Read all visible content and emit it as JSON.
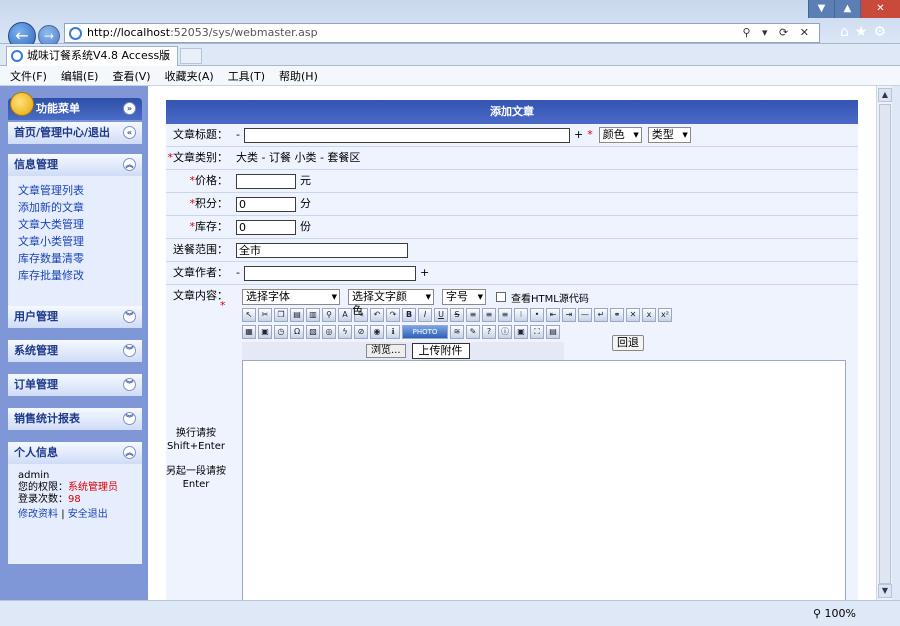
{
  "browser": {
    "address_host": "http://localhost",
    "address_rest": ":52053/sys/webmaster.asp",
    "tab_title": "城味订餐系统V4.8 Access版",
    "tab_close": "×",
    "zoom": "100%",
    "menu": [
      "文件(F)",
      "编辑(E)",
      "查看(V)",
      "收藏夹(A)",
      "工具(T)",
      "帮助(H)"
    ]
  },
  "sidebar": {
    "header": "功能菜单",
    "home": "首页/管理中心/退出",
    "info_mgmt": {
      "title": "信息管理",
      "links": [
        "文章管理列表",
        "添加新的文章",
        "文章大类管理",
        "文章小类管理",
        "库存数量清零",
        "库存批量修改"
      ]
    },
    "sections": [
      "用户管理",
      "系统管理",
      "订单管理",
      "销售统计报表"
    ],
    "personal": {
      "title": "个人信息",
      "username": "admin",
      "perm_label": "您的权限：",
      "perm_value": "系统管理员",
      "login_label": "登录次数：",
      "login_value": "98",
      "edit_link": "修改资料",
      "sep": "|",
      "logout_link": "安全退出"
    }
  },
  "form": {
    "header": "添加文章",
    "title_label": "文章标题：",
    "dash": "-",
    "plus": "+",
    "star": "*",
    "color_select": "颜色",
    "type_select": "类型",
    "category_label": "文章类别：",
    "category_value": "大类 - 订餐  小类 - 套餐区",
    "price_label": "价格：",
    "price_unit": "元",
    "points_label": "积分：",
    "points_value": "0",
    "points_unit": "分",
    "stock_label": "库存：",
    "stock_value": "0",
    "stock_unit": "份",
    "range_label": "送餐范围：",
    "range_value": "全市",
    "author_label": "文章作者：",
    "content_label": "文章内容：",
    "font_select": "选择字体",
    "color_text_select": "选择文字颜色",
    "size_select": "字号",
    "view_html": "查看HTML源代码",
    "browse_btn": "浏览...",
    "upload_btn": "上传附件",
    "back_btn": "回退",
    "hint1": "换行请按Shift+Enter",
    "hint2": "另起一段请按Enter"
  }
}
